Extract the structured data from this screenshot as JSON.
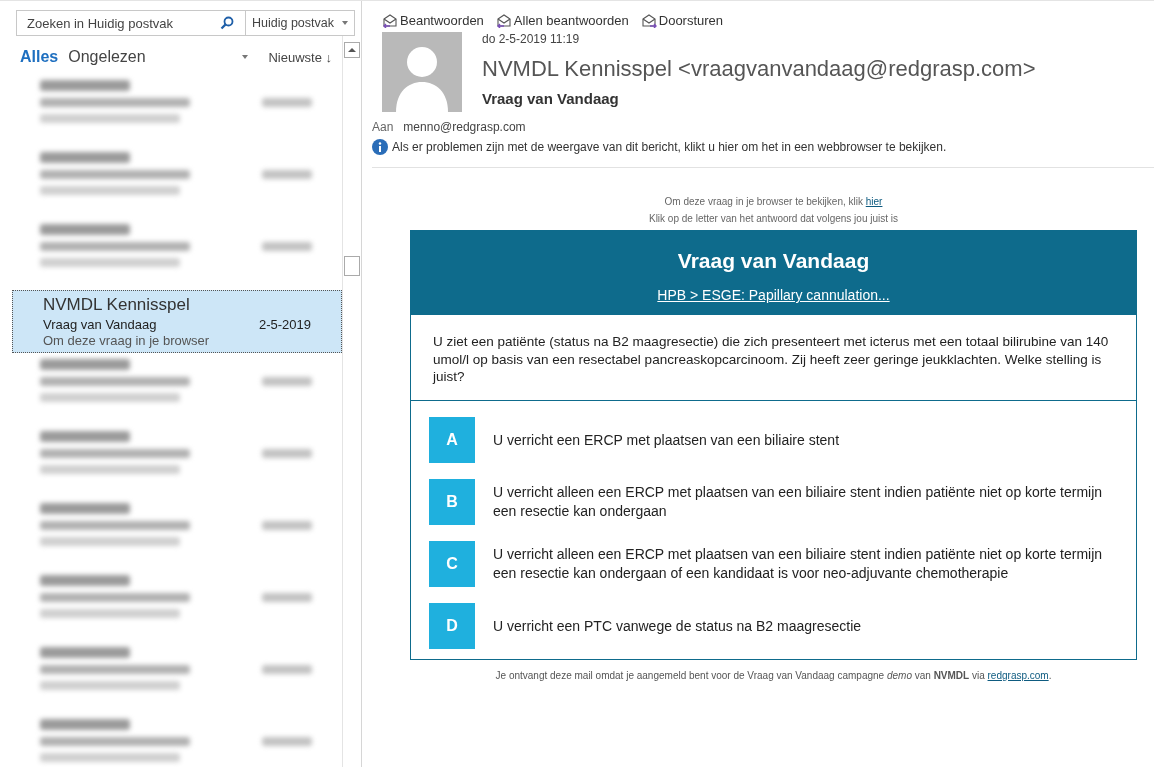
{
  "search": {
    "placeholder": "Zoeken in Huidig postvak",
    "scope": "Huidig postvak"
  },
  "filters": [
    {
      "label": "Alles",
      "selected": true
    },
    {
      "label": "Ongelezen",
      "selected": false
    }
  ],
  "sort": {
    "label": "Nieuwste ↓"
  },
  "messages": [
    {
      "kind": "blurred",
      "selected": false
    },
    {
      "kind": "blurred",
      "selected": false
    },
    {
      "kind": "blurred",
      "selected": false
    },
    {
      "kind": "message",
      "selected": true,
      "sender": "NVMDL Kennisspel",
      "subject": "Vraag van Vandaag",
      "date": "2-5-2019",
      "preview": "Om deze vraag in je browser"
    },
    {
      "kind": "blurred",
      "selected": false
    },
    {
      "kind": "blurred",
      "selected": false
    },
    {
      "kind": "blurred",
      "selected": false
    },
    {
      "kind": "blurred",
      "selected": false
    },
    {
      "kind": "blurred",
      "selected": false
    },
    {
      "kind": "blurred",
      "selected": false
    }
  ],
  "actions": [
    "Beantwoorden",
    "Allen beantwoorden",
    "Doorsturen"
  ],
  "reading": {
    "datetime": "do 2-5-2019 11:19",
    "from": "NVMDL Kennisspel <vraagvanvandaag@redgrasp.com>",
    "subject": "Vraag van Vandaag",
    "to_label": "Aan",
    "to": "menno@redgrasp.com",
    "info": "Als er problemen zijn met de weergave van dit bericht, klikt u hier om het in een webbrowser te bekijken."
  },
  "email": {
    "browser_text": "Om deze vraag in je browser te bekijken, klik",
    "browser_link": "hier",
    "instruction": "Klik op de letter van het antwoord dat volgens jou juist is",
    "title": "Vraag van Vandaag",
    "topic": "HPB > ESGE: Papillary cannulation...",
    "question": "U ziet een patiënte (status na B2 maagresectie) die zich presenteert met icterus met een totaal bilirubine van 140 umol/l op basis van een resectabel pancreaskopcarcinoom. Zij heeft zeer geringe jeukklachten. Welke stelling is juist?",
    "answers": [
      {
        "letter": "A",
        "text": "U verricht een ERCP met plaatsen van een biliaire stent"
      },
      {
        "letter": "B",
        "text": "U verricht alleen een ERCP met plaatsen van een biliaire stent indien patiënte niet op korte termijn een resectie kan ondergaan"
      },
      {
        "letter": "C",
        "text": "U verricht alleen een ERCP met plaatsen van een biliaire stent indien patiënte niet op korte termijn een resectie kan ondergaan of een kandidaat is voor neo-adjuvante chemotherapie"
      },
      {
        "letter": "D",
        "text": "U verricht een PTC vanwege de status na B2 maagresectie"
      }
    ],
    "footer_text": "Je ontvangt deze mail omdat je aangemeld bent voor de Vraag van Vandaag campagne *demo* van **NVMDL** via",
    "footer_link": "redgrasp.com",
    "footer_end": "."
  }
}
